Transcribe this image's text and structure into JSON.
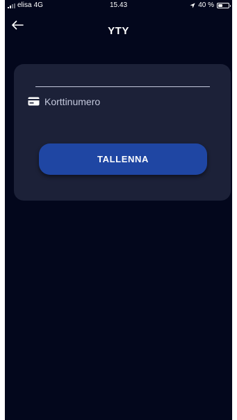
{
  "status_bar": {
    "carrier": "elisa",
    "network": "4G",
    "time": "15.43",
    "battery": "40 %",
    "battery_level": 0.4
  },
  "header": {
    "back_icon": "arrow-left-icon",
    "title": "YTY"
  },
  "form": {
    "card_icon": "credit-card-icon",
    "card_number_placeholder": "Korttinumero",
    "card_number_value": "",
    "save_label": "TALLENNA"
  },
  "colors": {
    "background": "#03071c",
    "card": "#1c2138",
    "accent": "#1f46a3",
    "text": "#ffffff",
    "muted_text": "#c4c9dd"
  }
}
